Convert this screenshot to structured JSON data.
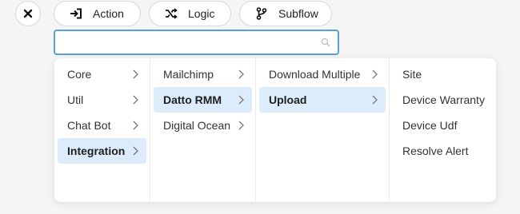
{
  "toolbar": {
    "action_label": "Action",
    "logic_label": "Logic",
    "subflow_label": "Subflow"
  },
  "search": {
    "value": "",
    "placeholder": ""
  },
  "menu": {
    "column1": [
      {
        "label": "Core"
      },
      {
        "label": "Util"
      },
      {
        "label": "Chat Bot"
      },
      {
        "label": "Integration"
      }
    ],
    "column2": [
      {
        "label": "Mailchimp"
      },
      {
        "label": "Datto RMM"
      },
      {
        "label": "Digital Ocean"
      }
    ],
    "column3": [
      {
        "label": "Download Multiple"
      },
      {
        "label": "Upload"
      }
    ],
    "column4": [
      {
        "label": "Site"
      },
      {
        "label": "Device Warranty"
      },
      {
        "label": "Device Udf"
      },
      {
        "label": "Resolve Alert"
      }
    ]
  },
  "icons": {
    "close": "close-icon",
    "action": "sign-in-arrow-icon",
    "logic": "shuffle-icon",
    "subflow": "branch-icon",
    "search": "search-icon",
    "chevron": "chevron-right-icon"
  },
  "colors": {
    "selected_bg": "#dcecfb",
    "focus_border": "#5aa0d8"
  }
}
